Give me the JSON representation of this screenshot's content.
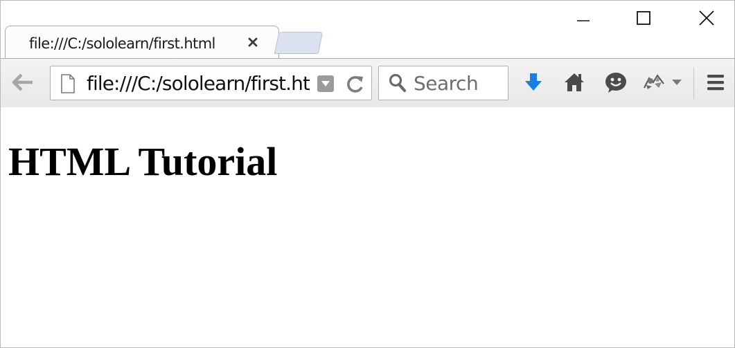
{
  "window": {
    "controls": [
      "minimize",
      "maximize",
      "close"
    ]
  },
  "tabs": [
    {
      "title": "file:///C:/sololearn/first.html",
      "active": true
    }
  ],
  "toolbar": {
    "url": "file:///C:/sololearn/first.html",
    "search_placeholder": "Search",
    "icons": [
      "back-arrow-icon",
      "page-icon",
      "dropdown-icon",
      "reload-icon",
      "search-icon",
      "download-icon",
      "home-icon",
      "chat-icon",
      "extension-icon",
      "hamburger-menu-icon"
    ]
  },
  "colors": {
    "download_blue": "#1a7fe3",
    "toolbar_icon": "#4a4a4a"
  },
  "page": {
    "heading": "HTML Tutorial"
  }
}
